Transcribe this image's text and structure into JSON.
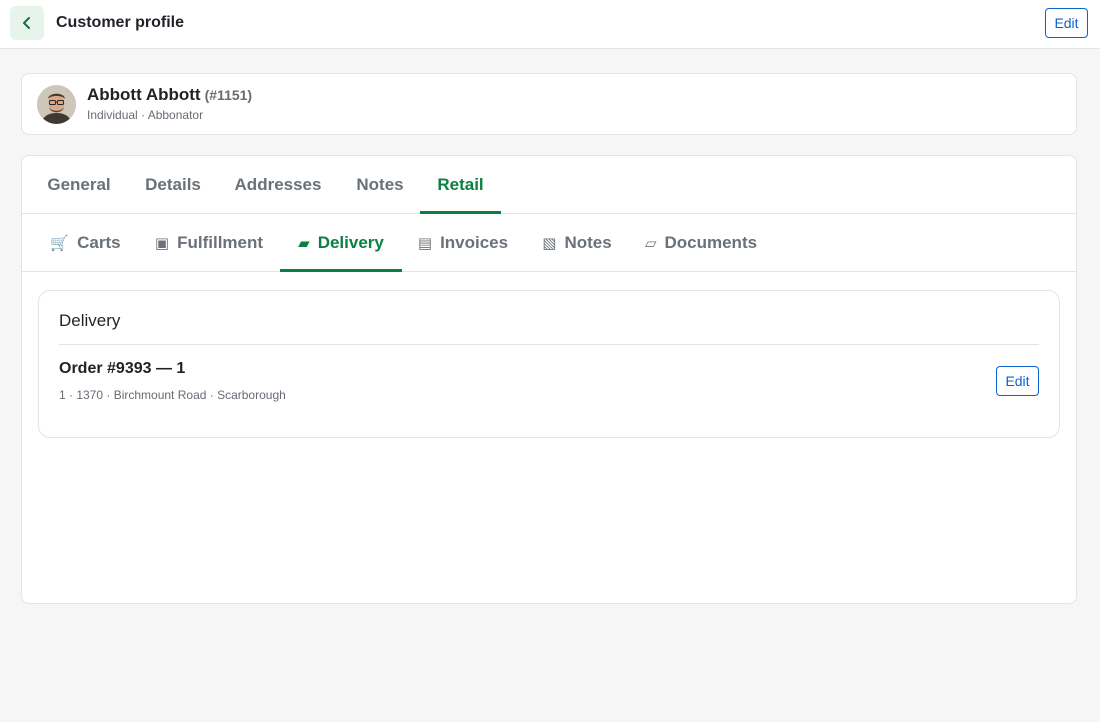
{
  "header": {
    "title": "Customer profile",
    "edit_label": "Edit",
    "back_icon": "chevron-left-icon"
  },
  "customer": {
    "name": "Abbott Abbott",
    "id": "(#1151)",
    "subtitle": "Individual · Abbonator"
  },
  "primary_tabs": [
    {
      "label": "General",
      "active": false
    },
    {
      "label": "Details",
      "active": false
    },
    {
      "label": "Addresses",
      "active": false
    },
    {
      "label": "Notes",
      "active": false
    },
    {
      "label": "Retail",
      "active": true
    }
  ],
  "secondary_tabs": [
    {
      "label": "Carts",
      "icon": "🛒",
      "icon_name": "cart-icon",
      "active": false
    },
    {
      "label": "Fulfillment",
      "icon": "▣",
      "icon_name": "box-icon",
      "active": false
    },
    {
      "label": "Delivery",
      "icon": "▰",
      "icon_name": "truck-icon",
      "active": true
    },
    {
      "label": "Invoices",
      "icon": "▤",
      "icon_name": "invoice-icon",
      "active": false
    },
    {
      "label": "Notes",
      "icon": "▧",
      "icon_name": "notes-icon",
      "active": false
    },
    {
      "label": "Documents",
      "icon": "▱",
      "icon_name": "document-icon",
      "active": false
    }
  ],
  "delivery": {
    "heading": "Delivery",
    "order": {
      "title": "Order #9393 — 1",
      "subtitle": "1 · 1370 · Birchmount Road · Scarborough",
      "edit_label": "Edit"
    }
  },
  "colors": {
    "accent_green": "#0a8042",
    "link_blue": "#0b63ce",
    "back_bg": "#e6f4ec"
  }
}
